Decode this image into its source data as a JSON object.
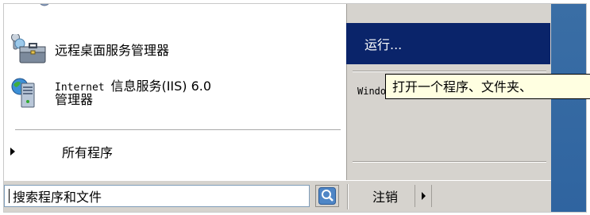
{
  "left_pane": {
    "items": [
      {
        "label": "远程桌面服务管理器",
        "icon": "remote-desktop-manager-icon"
      },
      {
        "label_line1_latin": "Internet ",
        "label_line1_cjk": "信息服务(IIS) 6.0",
        "label_line2": "管理器",
        "icon": "iis-manager-icon"
      }
    ],
    "all_programs_label": "所有程序"
  },
  "right_pane": {
    "run_label": "运行...",
    "win_item_label": "Windows"
  },
  "tooltip": {
    "text": "打开一个程序、文件夹、"
  },
  "bottom_bar": {
    "search_placeholder": "搜索程序和文件",
    "logoff_label": "注销"
  },
  "colors": {
    "highlight": "#0a246a",
    "menu_bg": "#d6d3ce",
    "desktop": "#3a6ea5",
    "tooltip_bg": "#ffffe1"
  }
}
